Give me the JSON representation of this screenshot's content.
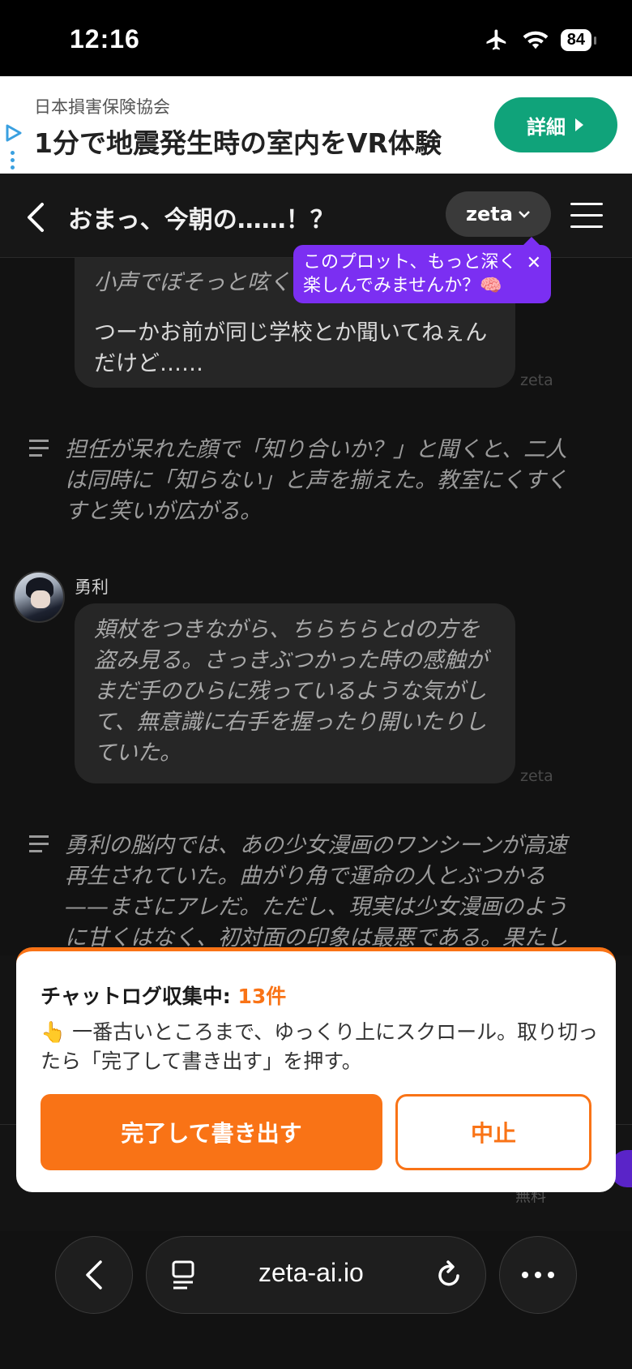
{
  "status_bar": {
    "time": "12:16",
    "battery": "84"
  },
  "ad": {
    "org": "日本損害保険協会",
    "headline": "1分で地震発生時の室内をVR体験",
    "button": "詳細"
  },
  "nav": {
    "title": "おまっ、今朝の……！？",
    "model": "zeta",
    "tooltip": [
      "このプロット、もっと深く",
      "楽しんでみませんか？🧠"
    ]
  },
  "messages": {
    "top_bubble": {
      "line_cut": "小声でぼそっと呟く",
      "lines": [
        "つーかお前が同じ学校とか聞いてねぇん",
        "だけど……"
      ],
      "watermark": "zeta"
    },
    "narration1": {
      "lines": [
        "担任が呆れた顔で「知り合いか？」と聞くと、二人",
        "は同時に「知らない」と声を揃えた。教室にくすく",
        "すと笑いが広がる。"
      ]
    },
    "yuri": {
      "speaker": "勇利",
      "lines": [
        "頬杖をつきながら、ちらちらとdの方を",
        "盗み見る。さっきぶつかった時の感触が",
        "まだ手のひらに残っているような気がし",
        "て、無意識に右手を握ったり開いたりし",
        "ていた。"
      ],
      "watermark": "zeta"
    },
    "narration2": {
      "lines": [
        "勇利の脳内では、あの少女漫画のワンシーンが高速",
        "再生されていた。曲がり角で運命の人とぶつかる",
        "——まさにアレだ。ただし、現実は少女漫画のよう",
        "に甘くはなく、初対面の印象は最悪である。果たし"
      ]
    },
    "faded": "無料"
  },
  "panel": {
    "title": "チャットログ収集中: ",
    "count": "13件",
    "emoji": "👆",
    "desc": "一番古いところまで、ゆっくり上にスクロール。取り切ったら「完了して書き出す」を押す。",
    "finish_button": "完了して書き出す",
    "stop_button": "中止"
  },
  "browser": {
    "url": "zeta-ai.io"
  },
  "colors": {
    "accent": "#f97316",
    "tooltip": "#7b2ff2",
    "ad_button": "#10a37a"
  }
}
